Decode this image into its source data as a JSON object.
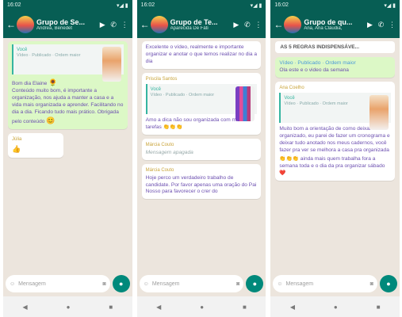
{
  "colors": {
    "header": "#075e54",
    "chat_bg": "#ece5dd",
    "incoming": "#ffffff",
    "outgoing": "#dcf8c6",
    "accent": "#00897b",
    "quote_bar": "#35b5a0"
  },
  "screens": [
    {
      "status": {
        "time": "16:02",
        "icons": "▾◢ ▮"
      },
      "header": {
        "title": "Grupo de Se...",
        "subtitle": "Andrea, Benedet"
      },
      "messages": [
        {
          "quote_name": "Você",
          "quote_sub": "Vídeo · Publicado · Ordem maior"
        },
        {
          "text": "Bom dia Elaine",
          "emoji": "🌻"
        },
        {
          "text": "Conteúdo muito bom, é importante a organização, nos ajuda a manter a casa e a vida mais organizada e aprender. Facilitando no dia a dia. Ficando tudo mais prático. Obrigada pelo conteúdo",
          "emoji": "😊"
        },
        {
          "sender": "Júlia",
          "text": "👍"
        }
      ],
      "input_placeholder": "Mensagem"
    },
    {
      "status": {
        "time": "16:02",
        "icons": "▾◢ ▮"
      },
      "header": {
        "title": "Grupo de Te...",
        "subtitle": "Aparecida De Fáti"
      },
      "messages": [
        {
          "text": "Excelente o vídeo, realmente e importante organizar e anotar o que temos realizar no dia a dia"
        },
        {
          "sender": "Priscila Santos",
          "quote_name": "Você",
          "quote_sub": "Vídeo · Publicado · Ordem maior"
        },
        {
          "text": "Amo a dica não sou organizada com minhas tarefas 👏👏👏"
        },
        {
          "sender": "Márcia Couto",
          "text": "Mensagem apagada"
        },
        {
          "sender": "Márcia Couto",
          "text": "Hoje perco um verdadeiro trabalho de candidate. Por favor apenas uma oração do Pai Nosso para favorecer o crer do"
        }
      ],
      "input_placeholder": "Mensagem"
    },
    {
      "status": {
        "time": "16:02",
        "icons": "▾◢ ▮"
      },
      "header": {
        "title": "Grupo de qu...",
        "subtitle": "Ana, Ana Cláudia,"
      },
      "messages": [
        {
          "banner": "AS 5 REGRAS INDISPENSÁVE..."
        },
        {
          "text": "Ola este e o video da semana",
          "link": "Vídeo · Publicado · Ordem maior"
        },
        {
          "sender": "Ana Coelho",
          "quote_name": "Você",
          "quote_sub": "Vídeo · Publicado · Ordem maior"
        },
        {
          "text": "Muito bom a orientação de como deixar tudo organizado, eu parei de fazer um cronograma e deixar tudo anotado nos meus cadernos, você fazer pra ver se melhora a casa pra organizada"
        },
        {
          "text": "👏👏👏 ainda mais quem trabalha fora a semana toda e o dia da pra organizar sábado ❤️"
        }
      ],
      "input_placeholder": "Mensagem"
    }
  ],
  "nav": {
    "back": "◀",
    "home": "●",
    "recents": "■"
  },
  "icons": {
    "back": "arrow-left",
    "video": "video-camera",
    "call": "phone",
    "menu": "more-vert",
    "emoji": "smiley",
    "camera": "camera",
    "mic": "microphone"
  }
}
